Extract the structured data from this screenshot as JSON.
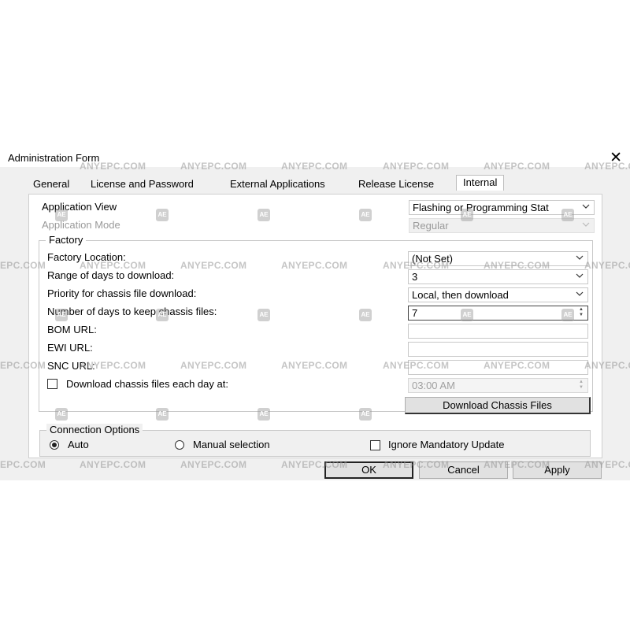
{
  "window": {
    "title": "Administration Form",
    "close_glyph": "✕"
  },
  "tabs": [
    {
      "label": "General"
    },
    {
      "label": "License and Password"
    },
    {
      "label": "External Applications"
    },
    {
      "label": "Release License"
    },
    {
      "label": "Internal",
      "active": true
    }
  ],
  "top": {
    "application_view_label": "Application View",
    "application_view_value": "Flashing or Programming Stat",
    "application_mode_label": "Application Mode",
    "application_mode_value": "Regular"
  },
  "factory": {
    "title": "Factory",
    "location_label": "Factory Location:",
    "location_value": "(Not Set)",
    "range_label": "Range of days to download:",
    "range_value": "3",
    "priority_label": "Priority for chassis file download:",
    "priority_value": "Local, then download",
    "keep_label": "Number of days to keep chassis files:",
    "keep_value": "7",
    "bom_label": "BOM URL:",
    "bom_value": "",
    "ewi_label": "EWI URL:",
    "ewi_value": "",
    "snc_label": "SNC URL:",
    "snc_value": "",
    "daily_label": "Download chassis files each day at:",
    "daily_checked": false,
    "daily_time": "03:00 AM",
    "download_button": "Download Chassis Files"
  },
  "connection": {
    "title": "Connection Options",
    "auto_label": "Auto",
    "auto_selected": true,
    "manual_label": "Manual selection",
    "manual_selected": false,
    "ignore_label": "Ignore Mandatory Update",
    "ignore_checked": false
  },
  "buttons": {
    "ok": "OK",
    "cancel": "Cancel",
    "apply": "Apply"
  },
  "watermark": {
    "text": "ANYEPC.COM",
    "partial_text": "EPC.COM",
    "badge": "AE",
    "color": "#969696"
  },
  "icons": {
    "dropdown": "chevron-down-icon",
    "close": "close-icon",
    "spinner": "spinner-icon"
  }
}
